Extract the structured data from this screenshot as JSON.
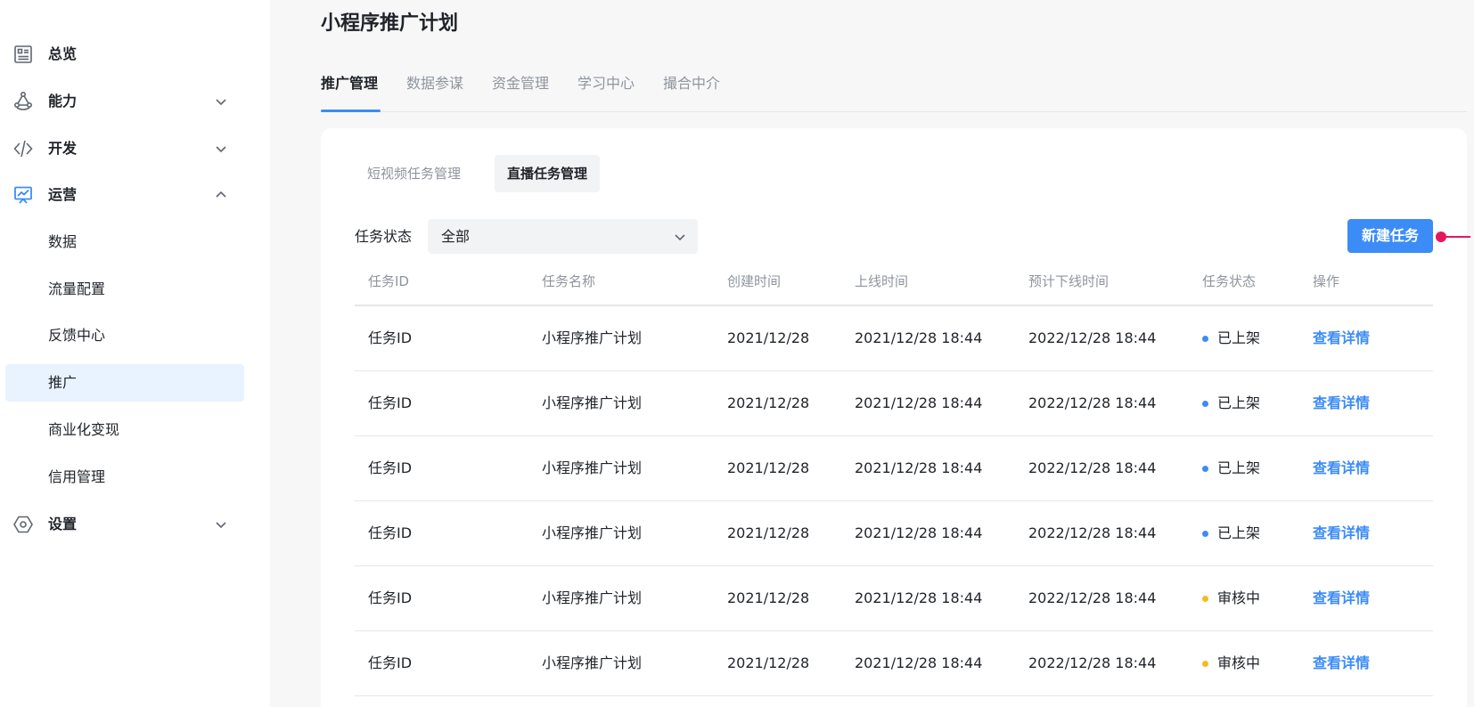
{
  "sidebar": {
    "items": [
      {
        "label": "总览",
        "icon": "dashboard-icon"
      },
      {
        "label": "能力",
        "icon": "ability-icon"
      },
      {
        "label": "开发",
        "icon": "code-icon"
      },
      {
        "label": "运营",
        "icon": "chart-board-icon"
      },
      {
        "label": "设置",
        "icon": "settings-icon"
      }
    ],
    "sub_items": [
      "数据",
      "流量配置",
      "反馈中心",
      "推广",
      "商业化变现",
      "信用管理"
    ],
    "active_sub": "推广"
  },
  "page": {
    "title": "小程序推广计划",
    "tabs": [
      "推广管理",
      "数据参谋",
      "资金管理",
      "学习中心",
      "撮合中介"
    ],
    "active_tab": "推广管理"
  },
  "card": {
    "subtabs": [
      "短视频任务管理",
      "直播任务管理"
    ],
    "active_subtab": "直播任务管理",
    "filter": {
      "label": "任务状态",
      "value": "全部"
    },
    "new_button": "新建任务"
  },
  "table": {
    "headers": [
      "任务ID",
      "任务名称",
      "创建时间",
      "上线时间",
      "预计下线时间",
      "任务状态",
      "操作"
    ],
    "rows": [
      {
        "id": "任务ID",
        "name": "小程序推广计划",
        "created": "2021/12/28",
        "online": "2021/12/28 18:44",
        "offline": "2022/12/28 18:44",
        "status": "已上架",
        "action": "查看详情"
      },
      {
        "id": "任务ID",
        "name": "小程序推广计划",
        "created": "2021/12/28",
        "online": "2021/12/28 18:44",
        "offline": "2022/12/28 18:44",
        "status": "已上架",
        "action": "查看详情"
      },
      {
        "id": "任务ID",
        "name": "小程序推广计划",
        "created": "2021/12/28",
        "online": "2021/12/28 18:44",
        "offline": "2022/12/28 18:44",
        "status": "已上架",
        "action": "查看详情"
      },
      {
        "id": "任务ID",
        "name": "小程序推广计划",
        "created": "2021/12/28",
        "online": "2021/12/28 18:44",
        "offline": "2022/12/28 18:44",
        "status": "已上架",
        "action": "查看详情"
      },
      {
        "id": "任务ID",
        "name": "小程序推广计划",
        "created": "2021/12/28",
        "online": "2021/12/28 18:44",
        "offline": "2022/12/28 18:44",
        "status": "审核中",
        "action": "查看详情"
      },
      {
        "id": "任务ID",
        "name": "小程序推广计划",
        "created": "2021/12/28",
        "online": "2021/12/28 18:44",
        "offline": "2022/12/28 18:44",
        "status": "审核中",
        "action": "查看详情"
      }
    ]
  },
  "colors": {
    "accent": "#3c8cf7",
    "status_listed": "#3c8cf7",
    "status_reviewing": "#f7ba1e",
    "active_nav_bg": "#e8f3ff",
    "pin": "#e5175c"
  }
}
